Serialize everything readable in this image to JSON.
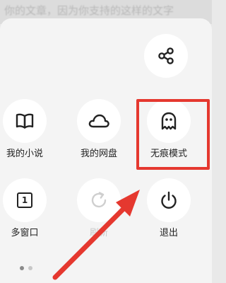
{
  "background": {
    "blurred_text": "你的文章，因为你支持的这样的文字"
  },
  "menu": {
    "share": {
      "icon": "share-icon"
    },
    "items": [
      {
        "label": "我的小说",
        "icon": "book-icon",
        "enabled": true
      },
      {
        "label": "我的网盘",
        "icon": "cloud-icon",
        "enabled": true
      },
      {
        "label": "无痕模式",
        "icon": "ghost-icon",
        "enabled": true
      },
      {
        "label": "多窗口",
        "icon": "window-count-icon",
        "window_count": "1",
        "enabled": true
      },
      {
        "label": "刷新",
        "icon": "refresh-icon",
        "enabled": false
      },
      {
        "label": "退出",
        "icon": "power-icon",
        "enabled": true
      }
    ],
    "pagination": {
      "pages": 2,
      "current": 1
    }
  },
  "annotation": {
    "highlight_color": "#e5382f",
    "arrow_color": "#e5382f"
  },
  "colors": {
    "panel": "#f4f4f4",
    "icon_bg": "#ffffff",
    "icon_stroke": "#222222",
    "disabled": "#c9c9c9"
  }
}
